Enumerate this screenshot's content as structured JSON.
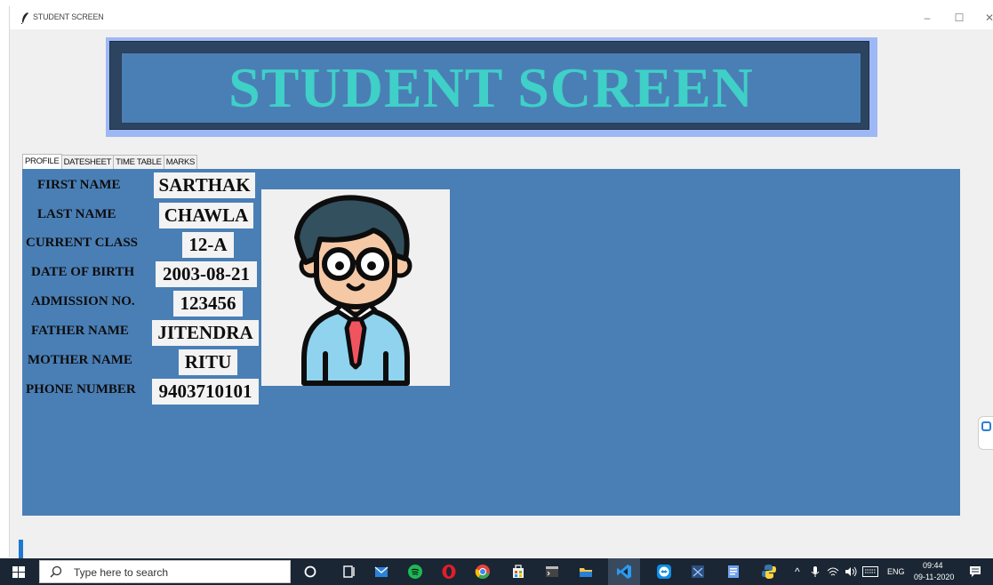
{
  "window": {
    "title": "STUDENT SCREEN",
    "controls": {
      "minimize": "–",
      "maximize": "☐",
      "close": "✕"
    }
  },
  "banner": {
    "text": "STUDENT SCREEN",
    "text_color": "#3fd0c7",
    "bg_color": "#4a7fb6"
  },
  "tabs": [
    {
      "label": "PROFILE",
      "active": true
    },
    {
      "label": "DATESHEET",
      "active": false
    },
    {
      "label": "TIME TABLE",
      "active": false
    },
    {
      "label": "MARKS",
      "active": false
    }
  ],
  "profile": {
    "fields": [
      {
        "label": "FIRST NAME",
        "value": "SARTHAK"
      },
      {
        "label": "LAST NAME",
        "value": "CHAWLA"
      },
      {
        "label": "CURRENT CLASS",
        "value": "12-A"
      },
      {
        "label": "DATE OF BIRTH",
        "value": "2003-08-21"
      },
      {
        "label": "ADMISSION NO.",
        "value": "123456"
      },
      {
        "label": "FATHER NAME",
        "value": "JITENDRA"
      },
      {
        "label": "MOTHER NAME",
        "value": "RITU"
      },
      {
        "label": "PHONE NUMBER",
        "value": "9403710101"
      }
    ],
    "avatar": "student-avatar-icon",
    "panel_color": "#4a7fb6"
  },
  "taskbar": {
    "search_placeholder": "Type here to search",
    "language": "ENG",
    "time": "09:44",
    "date": "09-11-2020",
    "pinned_icons": [
      "cortana-icon",
      "task-view-icon",
      "mail-icon",
      "spotify-icon",
      "opera-icon",
      "chrome-icon",
      "store-icon",
      "terminal-icon",
      "file-explorer-icon",
      "vscode-icon",
      "teamviewer-icon",
      "snipping-icon",
      "notepad-icon",
      "python-icon"
    ]
  }
}
